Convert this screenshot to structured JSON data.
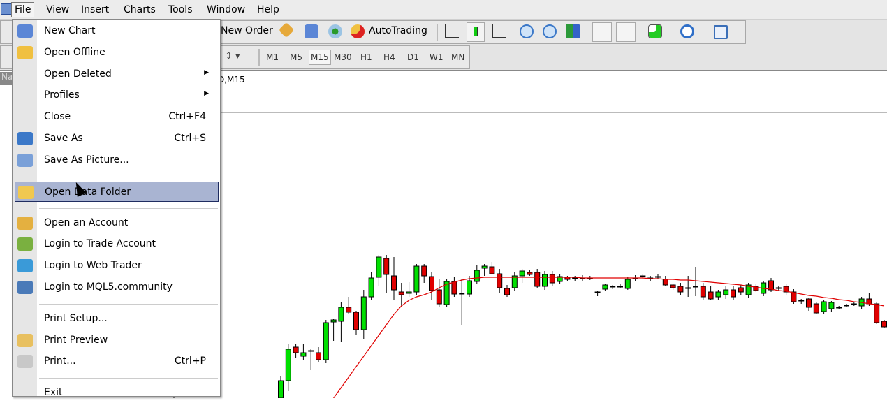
{
  "menubar": {
    "items": [
      "File",
      "View",
      "Insert",
      "Charts",
      "Tools",
      "Window",
      "Help"
    ]
  },
  "toolbar": {
    "new_order": "New Order",
    "autotrading": "AutoTrading",
    "timeframes": [
      "M1",
      "M5",
      "M15",
      "M30",
      "H1",
      "H4",
      "D1",
      "W1",
      "MN"
    ],
    "active_timeframe": "M15",
    "icons": [
      "expert-advisors-icon",
      "market-watch-icon",
      "signals-icon",
      "autotrading-icon",
      "bar-chart-icon",
      "candlestick-icon",
      "line-chart-icon",
      "zoom-in-icon",
      "zoom-out-icon",
      "tile-windows-icon",
      "chart-shift-icon",
      "auto-scroll-icon",
      "indicators-icon",
      "periods-icon",
      "templates-icon"
    ]
  },
  "navigator": {
    "label": "Na"
  },
  "chart": {
    "title": "D,M15",
    "colors": {
      "bull": "#00e000",
      "bear": "#e00000",
      "ma": "#e00000"
    }
  },
  "file_menu": {
    "items": [
      {
        "label": "New Chart",
        "icon": "new-chart-icon"
      },
      {
        "label": "Open Offline",
        "icon": "open-folder-icon"
      },
      {
        "label": "Open Deleted",
        "submenu": true
      },
      {
        "label": "Profiles",
        "submenu": true
      },
      {
        "label": "Close",
        "shortcut": "Ctrl+F4"
      },
      {
        "label": "Save As",
        "shortcut": "Ctrl+S",
        "icon": "save-icon"
      },
      {
        "label": "Save As Picture...",
        "icon": "save-picture-icon"
      },
      {
        "sep": true
      },
      {
        "label": "Open Data Folder",
        "icon": "folder-icon",
        "highlighted": true
      },
      {
        "sep": true
      },
      {
        "label": "Open an Account",
        "icon": "user-add-icon"
      },
      {
        "label": "Login to Trade Account",
        "icon": "user-login-icon"
      },
      {
        "label": "Login to Web Trader",
        "icon": "globe-icon"
      },
      {
        "label": "Login to MQL5.community",
        "icon": "mql5-icon"
      },
      {
        "sep": true
      },
      {
        "label": "Print Setup..."
      },
      {
        "label": "Print Preview",
        "icon": "print-preview-icon"
      },
      {
        "label": "Print...",
        "shortcut": "Ctrl+P",
        "icon": "printer-icon"
      },
      {
        "sep": true
      },
      {
        "label": "Exit"
      }
    ]
  },
  "chart_data": {
    "type": "candlestick",
    "ohlc": [
      [
        30,
        62,
        25,
        55
      ],
      [
        55,
        107,
        40,
        100
      ],
      [
        103,
        108,
        88,
        95
      ],
      [
        90,
        108,
        85,
        95
      ],
      [
        98,
        100,
        70,
        98
      ],
      [
        95,
        103,
        82,
        85
      ],
      [
        85,
        142,
        80,
        138
      ],
      [
        139,
        143,
        112,
        142
      ],
      [
        140,
        168,
        110,
        160
      ],
      [
        160,
        175,
        150,
        153
      ],
      [
        153,
        155,
        120,
        128
      ],
      [
        128,
        185,
        115,
        175
      ],
      [
        175,
        210,
        170,
        202
      ],
      [
        203,
        235,
        190,
        232
      ],
      [
        230,
        235,
        180,
        207
      ],
      [
        205,
        232,
        170,
        185
      ],
      [
        182,
        195,
        162,
        178
      ],
      [
        180,
        196,
        175,
        182
      ],
      [
        182,
        222,
        178,
        219
      ],
      [
        219,
        222,
        195,
        205
      ],
      [
        204,
        210,
        170,
        184
      ],
      [
        185,
        200,
        160,
        165
      ],
      [
        164,
        200,
        160,
        197
      ],
      [
        197,
        203,
        175,
        179
      ],
      [
        180,
        200,
        135,
        180
      ],
      [
        179,
        205,
        175,
        198
      ],
      [
        197,
        220,
        193,
        213
      ],
      [
        216,
        222,
        205,
        219
      ],
      [
        218,
        225,
        208,
        208
      ],
      [
        208,
        215,
        180,
        188
      ],
      [
        187,
        192,
        175,
        178
      ],
      [
        188,
        210,
        183,
        205
      ],
      [
        205,
        215,
        195,
        212
      ],
      [
        210,
        213,
        205,
        207
      ],
      [
        210,
        215,
        188,
        190
      ],
      [
        190,
        212,
        185,
        207
      ],
      [
        207,
        212,
        190,
        195
      ],
      [
        197,
        208,
        194,
        204
      ],
      [
        203,
        205,
        198,
        200
      ],
      [
        202,
        205,
        198,
        202
      ],
      [
        202,
        206,
        198,
        202
      ],
      [
        202,
        205,
        199,
        202
      ],
      [
        182,
        184,
        176,
        182
      ],
      [
        186,
        194,
        184,
        192
      ],
      [
        190,
        192,
        186,
        190
      ],
      [
        190,
        193,
        187,
        190
      ],
      [
        187,
        203,
        185,
        200
      ],
      [
        202,
        206,
        198,
        202
      ],
      [
        205,
        208,
        200,
        205
      ],
      [
        202,
        205,
        198,
        202
      ],
      [
        204,
        207,
        200,
        204
      ],
      [
        200,
        205,
        190,
        192
      ],
      [
        192,
        194,
        185,
        188
      ],
      [
        190,
        195,
        178,
        182
      ],
      [
        188,
        205,
        175,
        188
      ],
      [
        190,
        218,
        176,
        190
      ],
      [
        190,
        195,
        170,
        175
      ],
      [
        182,
        190,
        170,
        172
      ],
      [
        175,
        185,
        170,
        182
      ],
      [
        178,
        190,
        172,
        185
      ],
      [
        185,
        190,
        170,
        175
      ],
      [
        188,
        192,
        178,
        182
      ],
      [
        178,
        195,
        174,
        192
      ],
      [
        190,
        194,
        182,
        184
      ],
      [
        180,
        198,
        176,
        195
      ],
      [
        198,
        202,
        182,
        185
      ],
      [
        188,
        190,
        184,
        188
      ],
      [
        190,
        194,
        178,
        182
      ],
      [
        182,
        186,
        165,
        168
      ],
      [
        170,
        172,
        165,
        170
      ],
      [
        172,
        174,
        155,
        160
      ],
      [
        165,
        167,
        150,
        152
      ],
      [
        154,
        170,
        150,
        168
      ],
      [
        158,
        169,
        154,
        167
      ],
      [
        160,
        162,
        158,
        160
      ],
      [
        163,
        165,
        160,
        163
      ],
      [
        165,
        167,
        162,
        165
      ],
      [
        162,
        175,
        158,
        172
      ],
      [
        172,
        180,
        162,
        165
      ],
      [
        165,
        168,
        136,
        138
      ],
      [
        140,
        142,
        130,
        132
      ]
    ],
    "ma": [
      null,
      null,
      null,
      null,
      null,
      null,
      null,
      30,
      45,
      60,
      75,
      90,
      105,
      120,
      135,
      150,
      162,
      170,
      175,
      178,
      182,
      188,
      193,
      196,
      199,
      201,
      202,
      203,
      203,
      203,
      203,
      203,
      203,
      203,
      203,
      203,
      203,
      203,
      203,
      203,
      202,
      202,
      202,
      202,
      202,
      202,
      202,
      202,
      202,
      201,
      201,
      200,
      200,
      199,
      199,
      198,
      197,
      196,
      195,
      194,
      193,
      192,
      190,
      189,
      187,
      186,
      184,
      183,
      181,
      179,
      177,
      176,
      174,
      173,
      171,
      170,
      168,
      167,
      165,
      164,
      162
    ]
  }
}
